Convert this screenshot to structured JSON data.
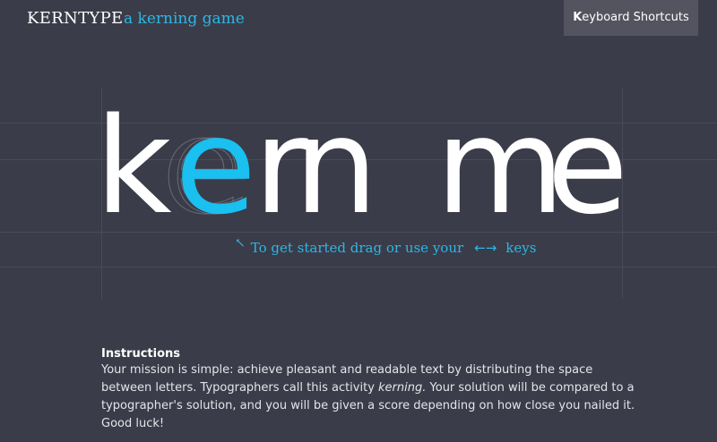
{
  "header": {
    "brand": "KERNTYPE",
    "tagline": "a kerning game",
    "keyboard_shortcuts_first": "K",
    "keyboard_shortcuts_rest": "eyboard Shortcuts"
  },
  "game": {
    "letters": [
      "k",
      "e",
      "r",
      "n",
      "m",
      "e"
    ],
    "active_letter_index": 1,
    "ghost_letters": [
      "e",
      "e"
    ],
    "hint": {
      "prefix": "To get started drag or use your",
      "arrows": "←→",
      "suffix": "keys"
    }
  },
  "instructions": {
    "heading": "Instructions",
    "text_before": "Your mission is simple: achieve pleasant and readable text by distributing the space between letters. Typographers call this activity ",
    "emphasis": "kerning.",
    "text_after": " Your solution will be compared to a typographer's solution, and you will be given a score depending on how close you nailed it. Good luck!"
  },
  "colors": {
    "background": "#3b3c49",
    "accent": "#19c0f0",
    "button_bg": "#53545f"
  }
}
